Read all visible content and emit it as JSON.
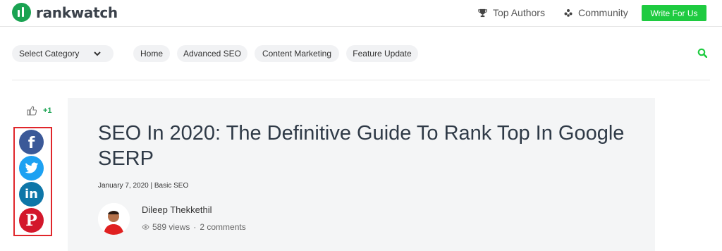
{
  "header": {
    "logo_text": "rankwatch",
    "top_authors": "Top Authors",
    "community": "Community",
    "write_btn": "Write For Us"
  },
  "nav": {
    "category": "Select Category",
    "pills": [
      "Home",
      "Advanced SEO",
      "Content Marketing",
      "Feature Update"
    ]
  },
  "article": {
    "like_count": "+1",
    "title": "SEO In 2020: The Definitive Guide To Rank Top In Google SERP",
    "date": "January 7, 2020",
    "separator": "|",
    "category": "Basic SEO",
    "author": "Dileep Thekkethil",
    "views": "589 views",
    "dot": "·",
    "comments": "2 comments"
  },
  "share": {
    "items": [
      {
        "name": "facebook",
        "color": "#3b5998",
        "glyph": "f"
      },
      {
        "name": "twitter",
        "color": "#1da1f2",
        "glyph": ""
      },
      {
        "name": "linkedin",
        "color": "#0e76a8",
        "glyph": "in"
      },
      {
        "name": "pinterest",
        "color": "#d3172b",
        "glyph": "P"
      }
    ]
  },
  "colors": {
    "brand_green": "#1aa352",
    "button_green": "#1ecb40",
    "highlight_red": "#e0262b"
  }
}
